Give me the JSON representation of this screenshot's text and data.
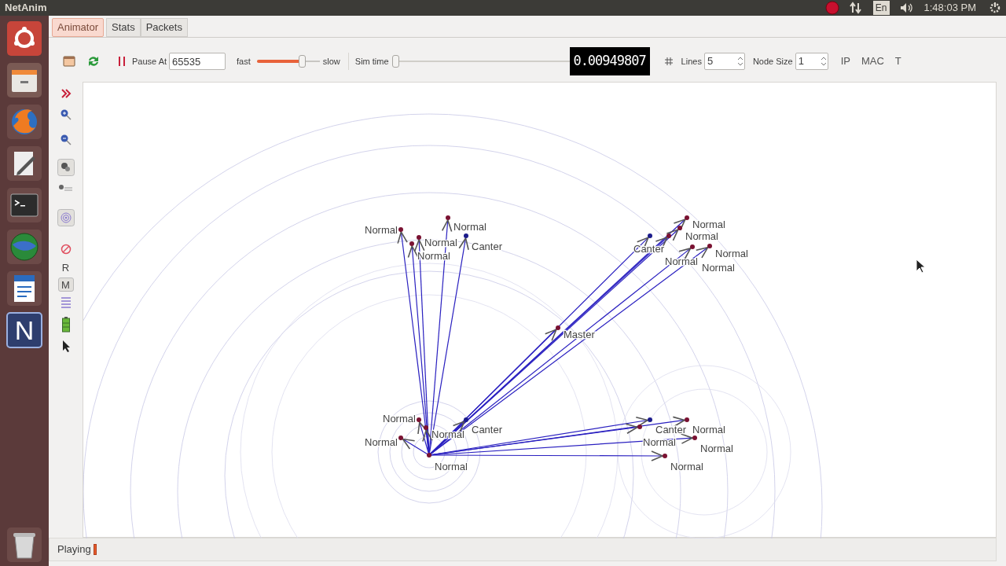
{
  "top_bar": {
    "title": "NetAnim",
    "keyboard": "En",
    "clock": "1:48:03 PM"
  },
  "launcher": {
    "app_letter": "N"
  },
  "tabs": [
    {
      "label": "Animator",
      "selected": true
    },
    {
      "label": "Stats",
      "selected": false
    },
    {
      "label": "Packets",
      "selected": false
    }
  ],
  "toolbar": {
    "pause_label": "Pause At",
    "pause_value": "65535",
    "speed_fast": "fast",
    "speed_slow": "slow",
    "speed": {
      "level": 0.72
    },
    "sim_time_label": "Sim time",
    "sim_time": {
      "level": 0.0
    },
    "time_display": "0.00949807",
    "lines_label": "Lines",
    "lines_value": "5",
    "node_size_label": "Node Size",
    "node_size_value": "1",
    "buttons": [
      "IP",
      "MAC",
      "T"
    ]
  },
  "side_tools": {
    "r_label": "R",
    "m_label": "M"
  },
  "nodes": [
    {
      "label": "Normal",
      "color": "#7a1232"
    },
    {
      "label": "Normal",
      "color": "#7a1232"
    },
    {
      "label": "Normal",
      "color": "#7a1232"
    },
    {
      "label": "Normal",
      "color": "#7a1232"
    },
    {
      "label": "Canter",
      "color": "#1c1c8c"
    },
    {
      "label": "Normal",
      "color": "#7a1232"
    },
    {
      "label": "Normal",
      "color": "#7a1232"
    },
    {
      "label": "Canter",
      "color": "#1c1c8c"
    },
    {
      "label": "Normal",
      "color": "#7a1232"
    },
    {
      "label": "Normal",
      "color": "#7a1232"
    },
    {
      "label": "Normal",
      "color": "#7a1232"
    },
    {
      "label": "Master",
      "color": "#7a1232"
    },
    {
      "label": "Normal",
      "color": "#7a1232"
    },
    {
      "label": "Normal",
      "color": "#7a1232"
    },
    {
      "label": "Normal",
      "color": "#7a1232"
    },
    {
      "label": "Normal",
      "color": "#7a1232"
    },
    {
      "label": "Canter",
      "color": "#1c1c8c"
    },
    {
      "label": "Canter",
      "color": "#1c1c8c"
    },
    {
      "label": "Normal",
      "color": "#7a1232"
    },
    {
      "label": "Normal",
      "color": "#7a1232"
    },
    {
      "label": "Normal",
      "color": "#7a1232"
    },
    {
      "label": "Normal",
      "color": "#7a1232"
    }
  ],
  "status": {
    "text": "Playing",
    "progress": {
      "level": 0.01
    }
  }
}
